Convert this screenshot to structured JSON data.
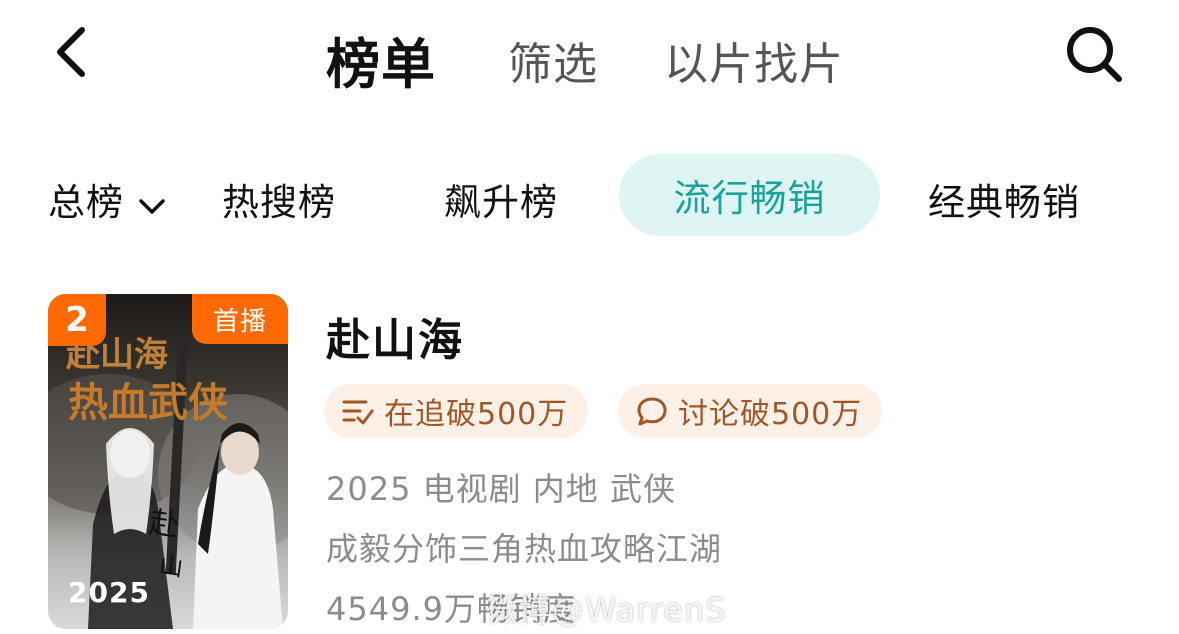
{
  "nav": {
    "back_icon": "chevron-left-icon",
    "tabs": [
      "榜单",
      "筛选",
      "以片找片"
    ],
    "search_icon": "search-icon"
  },
  "categories": {
    "dropdown_label": "总榜",
    "items": [
      "热搜榜",
      "飙升榜",
      "流行畅销",
      "经典畅销"
    ],
    "selected": "流行畅销",
    "accent_color": "#16a39a",
    "selected_bg": "#def5f3"
  },
  "item": {
    "rank": "2",
    "badge": "首播",
    "poster_year": "2025",
    "poster_title_art": "热血武侠",
    "title": "赴山海",
    "chips": [
      {
        "icon": "follow-list-icon",
        "label": "在追破500万"
      },
      {
        "icon": "comment-icon",
        "label": "讨论破500万"
      }
    ],
    "meta_line": "2025 电视剧 内地 武侠",
    "description": "成毅分饰三角热血攻略江湖",
    "heat": "4549.9万畅销度",
    "badge_color": "#ff6a00"
  },
  "watermark": "微博@WarrenS"
}
